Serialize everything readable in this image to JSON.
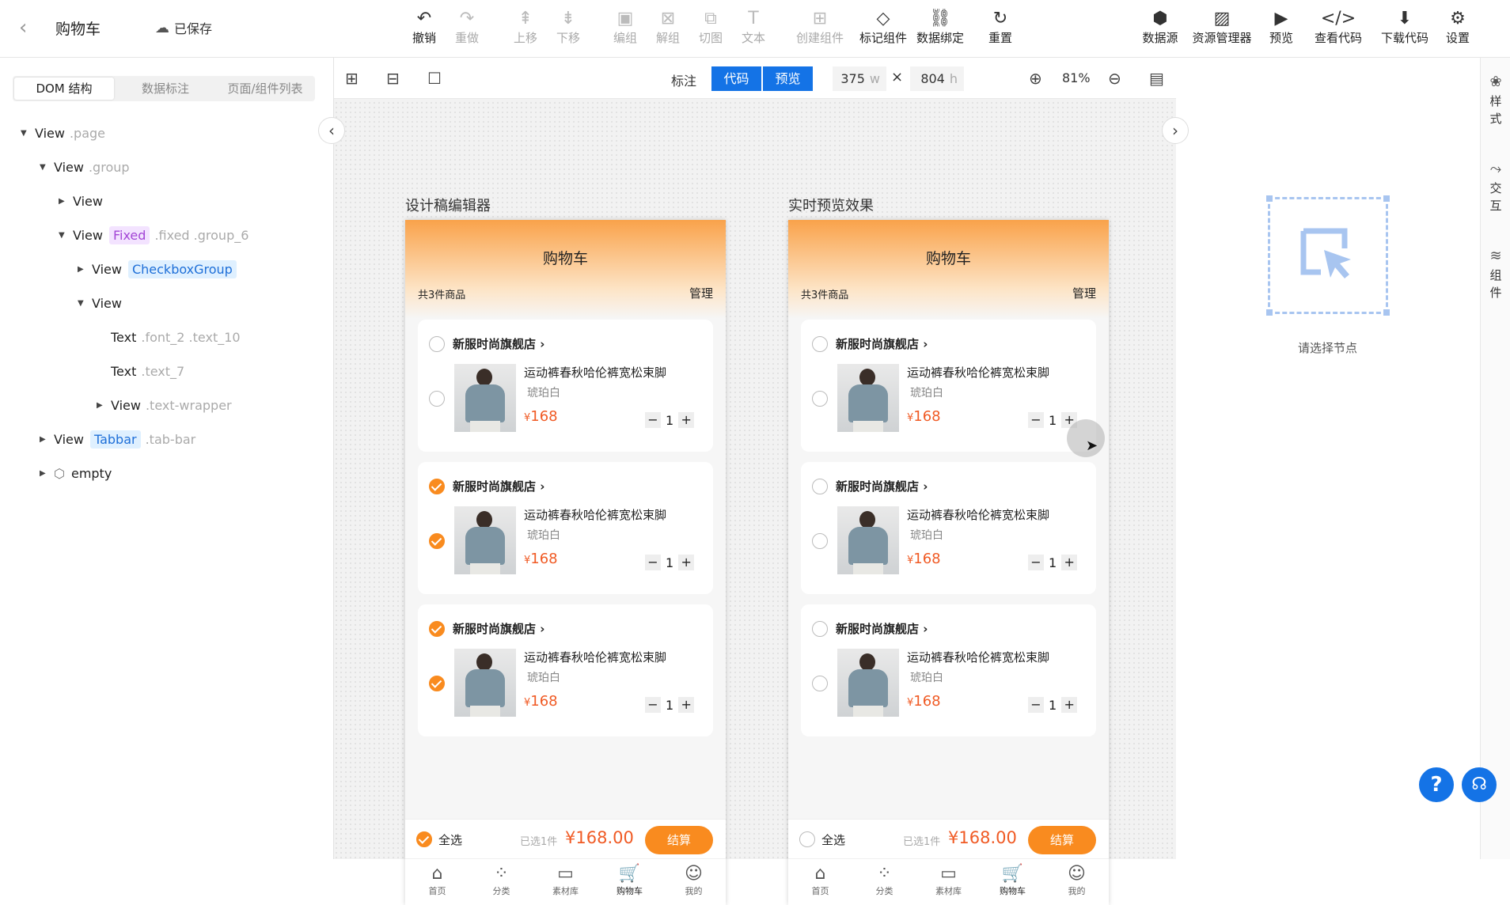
{
  "app": {
    "title": "购物车",
    "saved": "已保存"
  },
  "toolbar": [
    {
      "label": "撤销",
      "icon": "undo-icon",
      "glyph": "↶",
      "enabled": true
    },
    {
      "label": "重做",
      "icon": "redo-icon",
      "glyph": "↷",
      "enabled": false
    },
    {
      "label": "上移",
      "icon": "move-up-icon",
      "glyph": "⇞",
      "enabled": false
    },
    {
      "label": "下移",
      "icon": "move-down-icon",
      "glyph": "⇟",
      "enabled": false
    },
    {
      "label": "编组",
      "icon": "group-icon",
      "glyph": "▣",
      "enabled": false
    },
    {
      "label": "解组",
      "icon": "ungroup-icon",
      "glyph": "⊠",
      "enabled": false
    },
    {
      "label": "切图",
      "icon": "slice-icon",
      "glyph": "⧉",
      "enabled": false
    },
    {
      "label": "文本",
      "icon": "text-icon",
      "glyph": "T",
      "enabled": false
    },
    {
      "label": "创建组件",
      "icon": "create-component-icon",
      "glyph": "⊞",
      "enabled": false
    },
    {
      "label": "标记组件",
      "icon": "tag-component-icon",
      "glyph": "◇",
      "enabled": true
    },
    {
      "label": "数据绑定",
      "icon": "link-icon",
      "glyph": "⛓",
      "enabled": true
    },
    {
      "label": "重置",
      "icon": "reset-icon",
      "glyph": "↻",
      "enabled": true
    },
    {
      "label": "数据源",
      "icon": "datasource-icon",
      "glyph": "⬢",
      "enabled": true
    },
    {
      "label": "资源管理器",
      "icon": "image-icon",
      "glyph": "▨",
      "enabled": true
    },
    {
      "label": "预览",
      "icon": "play-icon",
      "glyph": "▶",
      "enabled": true
    },
    {
      "label": "查看代码",
      "icon": "code-icon",
      "glyph": "</>",
      "enabled": true
    },
    {
      "label": "下载代码",
      "icon": "download-icon",
      "glyph": "⬇",
      "enabled": true
    },
    {
      "label": "设置",
      "icon": "gear-icon",
      "glyph": "⚙",
      "enabled": true
    }
  ],
  "left": {
    "tabs": [
      "DOM 结构",
      "数据标注",
      "页面/组件列表"
    ],
    "tree": [
      {
        "tag": "View",
        "cls": ".page",
        "level": 0,
        "arrow": "▼"
      },
      {
        "tag": "View",
        "cls": ".group",
        "level": 1,
        "arrow": "▼"
      },
      {
        "tag": "View",
        "cls": "",
        "level": 2,
        "arrow": "▶"
      },
      {
        "tag": "View",
        "badge": "Fixed",
        "badgeType": "p",
        "cls": ".fixed .group_6",
        "level": 2,
        "arrow": "▼"
      },
      {
        "tag": "View",
        "badge": "CheckboxGroup",
        "badgeType": "b",
        "cls": "",
        "level": 3,
        "arrow": "▶"
      },
      {
        "tag": "View",
        "cls": "",
        "level": 3,
        "arrow": "▼"
      },
      {
        "tag": "Text",
        "cls": ".font_2 .text_10",
        "level": 4,
        "arrow": ""
      },
      {
        "tag": "Text",
        "cls": ".text_7",
        "level": 4,
        "arrow": ""
      },
      {
        "tag": "View",
        "cls": ".text-wrapper",
        "level": 4,
        "arrow": "▶"
      },
      {
        "tag": "View",
        "badge": "Tabbar",
        "badgeType": "b",
        "cls": ".tab-bar",
        "level": 1,
        "arrow": "▶"
      },
      {
        "tag": "empty",
        "cls": "",
        "level": 1,
        "arrow": "▶",
        "icon": "cube"
      }
    ]
  },
  "canvas": {
    "mark_label": "标注",
    "mode_code": "代码",
    "mode_preview": "预览",
    "width": "375",
    "width_unit": "w",
    "height": "804",
    "height_unit": "h",
    "times": "×",
    "zoom": "81%",
    "editor_label": "设计稿编辑器",
    "preview_label": "实时预览效果"
  },
  "phone": {
    "title": "购物车",
    "count": "共3件商品",
    "manage": "管理",
    "shop": "新服时尚旗舰店",
    "shop_arrow": "›",
    "product": "运动裤春秋哈伦裤宽松束脚",
    "color": "琥珀白",
    "currency": "¥",
    "price": "168",
    "qty": "1",
    "minus": "−",
    "plus": "+",
    "select_all": "全选",
    "selected": "已选1件",
    "total": "¥168.00",
    "checkout": "结算",
    "tabs": [
      {
        "label": "首页",
        "glyph": "⌂",
        "icon": "home-icon"
      },
      {
        "label": "分类",
        "glyph": "⁘",
        "icon": "category-icon"
      },
      {
        "label": "素材库",
        "glyph": "▭",
        "icon": "folder-icon"
      },
      {
        "label": "购物车",
        "glyph": "🛒",
        "icon": "cart-icon"
      },
      {
        "label": "我的",
        "glyph": "☺",
        "icon": "user-icon"
      }
    ],
    "editor_checks": [
      [
        false,
        false
      ],
      [
        true,
        true
      ],
      [
        true,
        true
      ]
    ],
    "preview_checks": [
      [
        false,
        false
      ],
      [
        false,
        false
      ],
      [
        false,
        false
      ]
    ],
    "editor_select_all": true,
    "preview_select_all": false
  },
  "right": {
    "placeholder": "请选择节点",
    "side": [
      {
        "label": "样式",
        "glyph": "❀",
        "icon": "style-icon"
      },
      {
        "label": "交互",
        "glyph": "⤳",
        "icon": "interaction-icon"
      },
      {
        "label": "组件",
        "glyph": "≋",
        "icon": "layers-icon"
      }
    ],
    "help": "?"
  },
  "colors": {
    "accent": "#1473e6",
    "orange": "#f98b1f",
    "price": "#f05a24"
  }
}
